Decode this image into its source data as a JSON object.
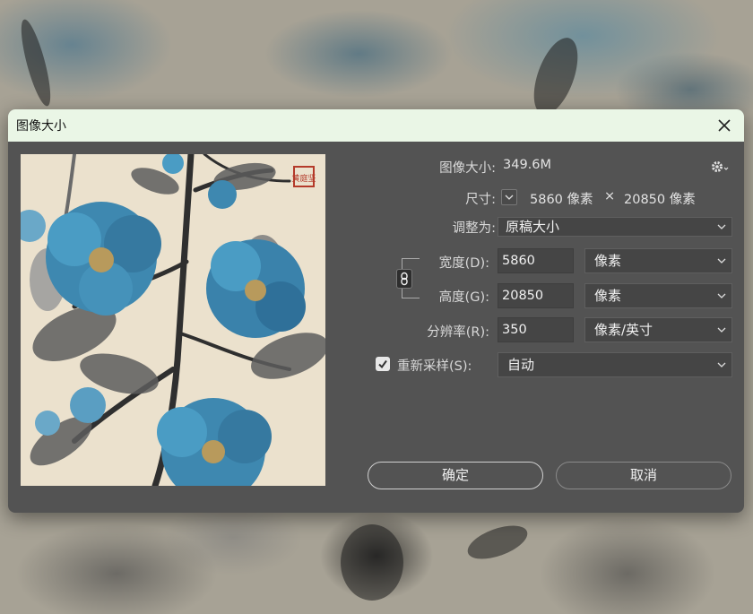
{
  "dialog": {
    "title": "图像大小"
  },
  "info": {
    "image_size_label": "图像大小:",
    "image_size_value": "349.6M",
    "dimensions_label": "尺寸:",
    "dimensions_width": "5860 像素",
    "dimensions_times": "×",
    "dimensions_height": "20850 像素"
  },
  "fit_to": {
    "label": "调整为:",
    "value": "原稿大小"
  },
  "width": {
    "label": "宽度(D):",
    "value": "5860",
    "unit": "像素"
  },
  "height": {
    "label": "高度(G):",
    "value": "20850",
    "unit": "像素"
  },
  "resolution": {
    "label": "分辨率(R):",
    "value": "350",
    "unit": "像素/英寸"
  },
  "resample": {
    "checked": true,
    "label": "重新采样(S):",
    "value": "自动"
  },
  "buttons": {
    "ok": "确定",
    "cancel": "取消"
  },
  "seal_text": "黄庭坚",
  "colors": {
    "dialog_bg": "#535353",
    "titlebar_bg": "#eaf6e6",
    "field_bg": "#454545",
    "flower_blue": "#3e88b0"
  }
}
